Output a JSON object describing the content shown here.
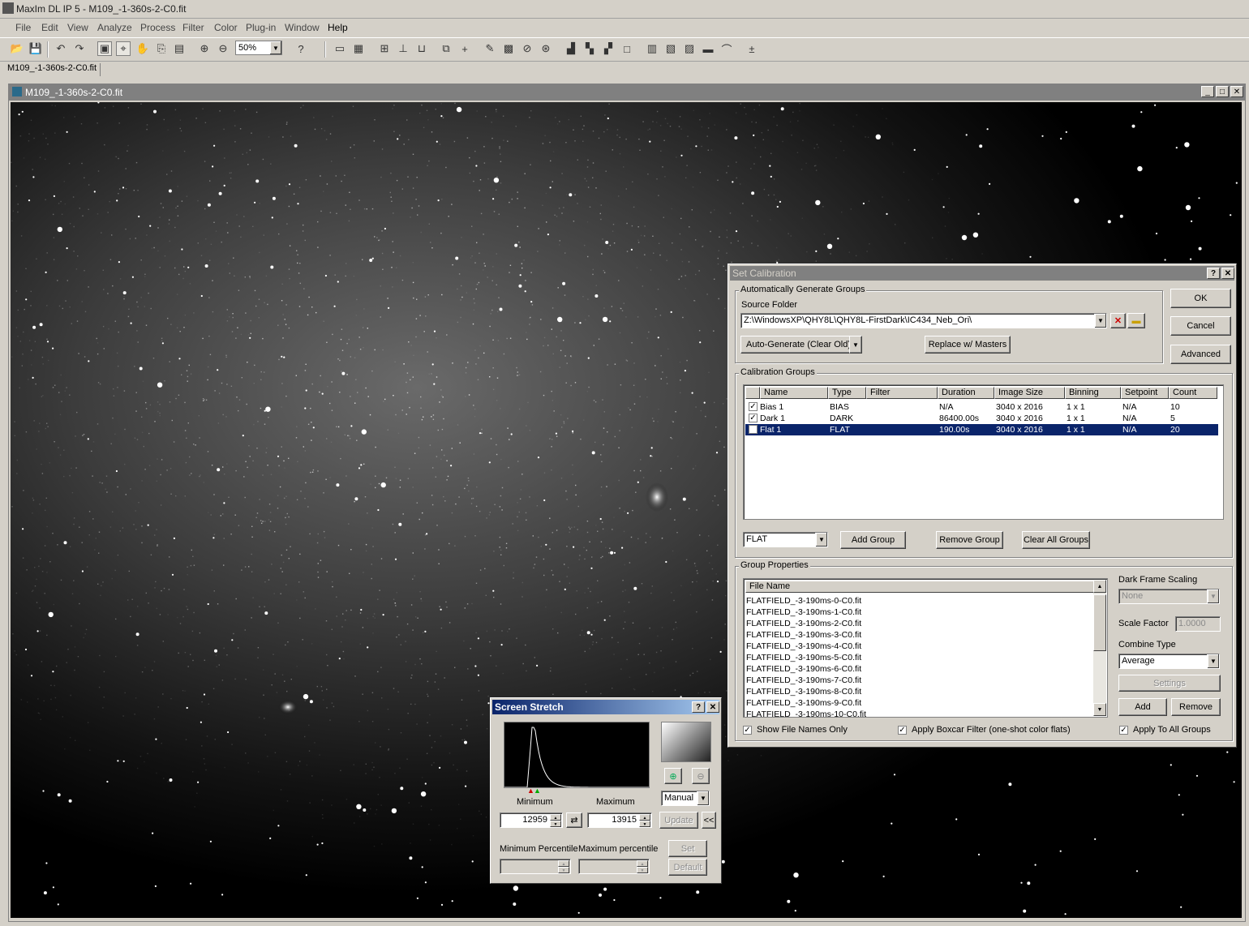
{
  "app": {
    "title": "MaxIm DL IP 5 - M109_-1-360s-2-C0.fit"
  },
  "menu": [
    "File",
    "Edit",
    "View",
    "Analyze",
    "Process",
    "Filter",
    "Color",
    "Plug-in",
    "Window",
    "Help"
  ],
  "toolbar": {
    "zoom_value": "50%"
  },
  "doc_tab": "M109_-1-360s-2-C0.fit",
  "image_window": {
    "title": "M109_-1-360s-2-C0.fit"
  },
  "calibration": {
    "title": "Set Calibration",
    "auto_group_label": "Automatically Generate Groups",
    "source_folder_label": "Source Folder",
    "source_folder_value": "Z:\\WindowsXP\\QHY8L\\QHY8L-FirstDark\\IC434_Neb_Ori\\",
    "auto_generate_label": "Auto-Generate (Clear Old)",
    "replace_masters_label": "Replace w/ Masters",
    "ok_label": "OK",
    "cancel_label": "Cancel",
    "advanced_label": "Advanced",
    "groups_label": "Calibration Groups",
    "columns": [
      "Name",
      "Type",
      "Filter",
      "Duration",
      "Image Size",
      "Binning",
      "Setpoint",
      "Count"
    ],
    "rows": [
      {
        "checked": true,
        "name": "Bias 1",
        "type": "BIAS",
        "filter": "",
        "duration": "N/A",
        "size": "3040 x 2016",
        "binning": "1 x 1",
        "setpoint": "N/A",
        "count": "10",
        "selected": false
      },
      {
        "checked": true,
        "name": "Dark 1",
        "type": "DARK",
        "filter": "",
        "duration": "86400.00s",
        "size": "3040 x 2016",
        "binning": "1 x 1",
        "setpoint": "N/A",
        "count": "5",
        "selected": false
      },
      {
        "checked": true,
        "name": "Flat 1",
        "type": "FLAT",
        "filter": "",
        "duration": "190.00s",
        "size": "3040 x 2016",
        "binning": "1 x 1",
        "setpoint": "N/A",
        "count": "20",
        "selected": true
      }
    ],
    "type_select_value": "FLAT",
    "add_group_label": "Add Group",
    "remove_group_label": "Remove Group",
    "clear_all_groups_label": "Clear All Groups",
    "group_props_label": "Group Properties",
    "file_name_header": "File Name",
    "files": [
      "FLATFIELD_-3-190ms-0-C0.fit",
      "FLATFIELD_-3-190ms-1-C0.fit",
      "FLATFIELD_-3-190ms-2-C0.fit",
      "FLATFIELD_-3-190ms-3-C0.fit",
      "FLATFIELD_-3-190ms-4-C0.fit",
      "FLATFIELD_-3-190ms-5-C0.fit",
      "FLATFIELD_-3-190ms-6-C0.fit",
      "FLATFIELD_-3-190ms-7-C0.fit",
      "FLATFIELD_-3-190ms-8-C0.fit",
      "FLATFIELD_-3-190ms-9-C0.fit",
      "FLATFIELD_-3-190ms-10-C0.fit"
    ],
    "dark_scaling_label": "Dark Frame Scaling",
    "dark_scaling_value": "None",
    "scale_factor_label": "Scale Factor",
    "scale_factor_value": "1.0000",
    "combine_type_label": "Combine Type",
    "combine_type_value": "Average",
    "settings_label": "Settings",
    "add_label": "Add",
    "remove_label": "Remove",
    "show_names_label": "Show File Names Only",
    "boxcar_label": "Apply Boxcar Filter (one-shot color flats)",
    "apply_all_label": "Apply To All Groups"
  },
  "stretch": {
    "title": "Screen Stretch",
    "minimum_label": "Minimum",
    "maximum_label": "Maximum",
    "minimum_value": "12959",
    "maximum_value": "13915",
    "mode_value": "Manual",
    "update_label": "Update",
    "collapse_label": "<<",
    "min_percentile_label": "Minimum Percentile",
    "max_percentile_label": "Maximum percentile",
    "set_label": "Set",
    "default_label": "Default"
  }
}
